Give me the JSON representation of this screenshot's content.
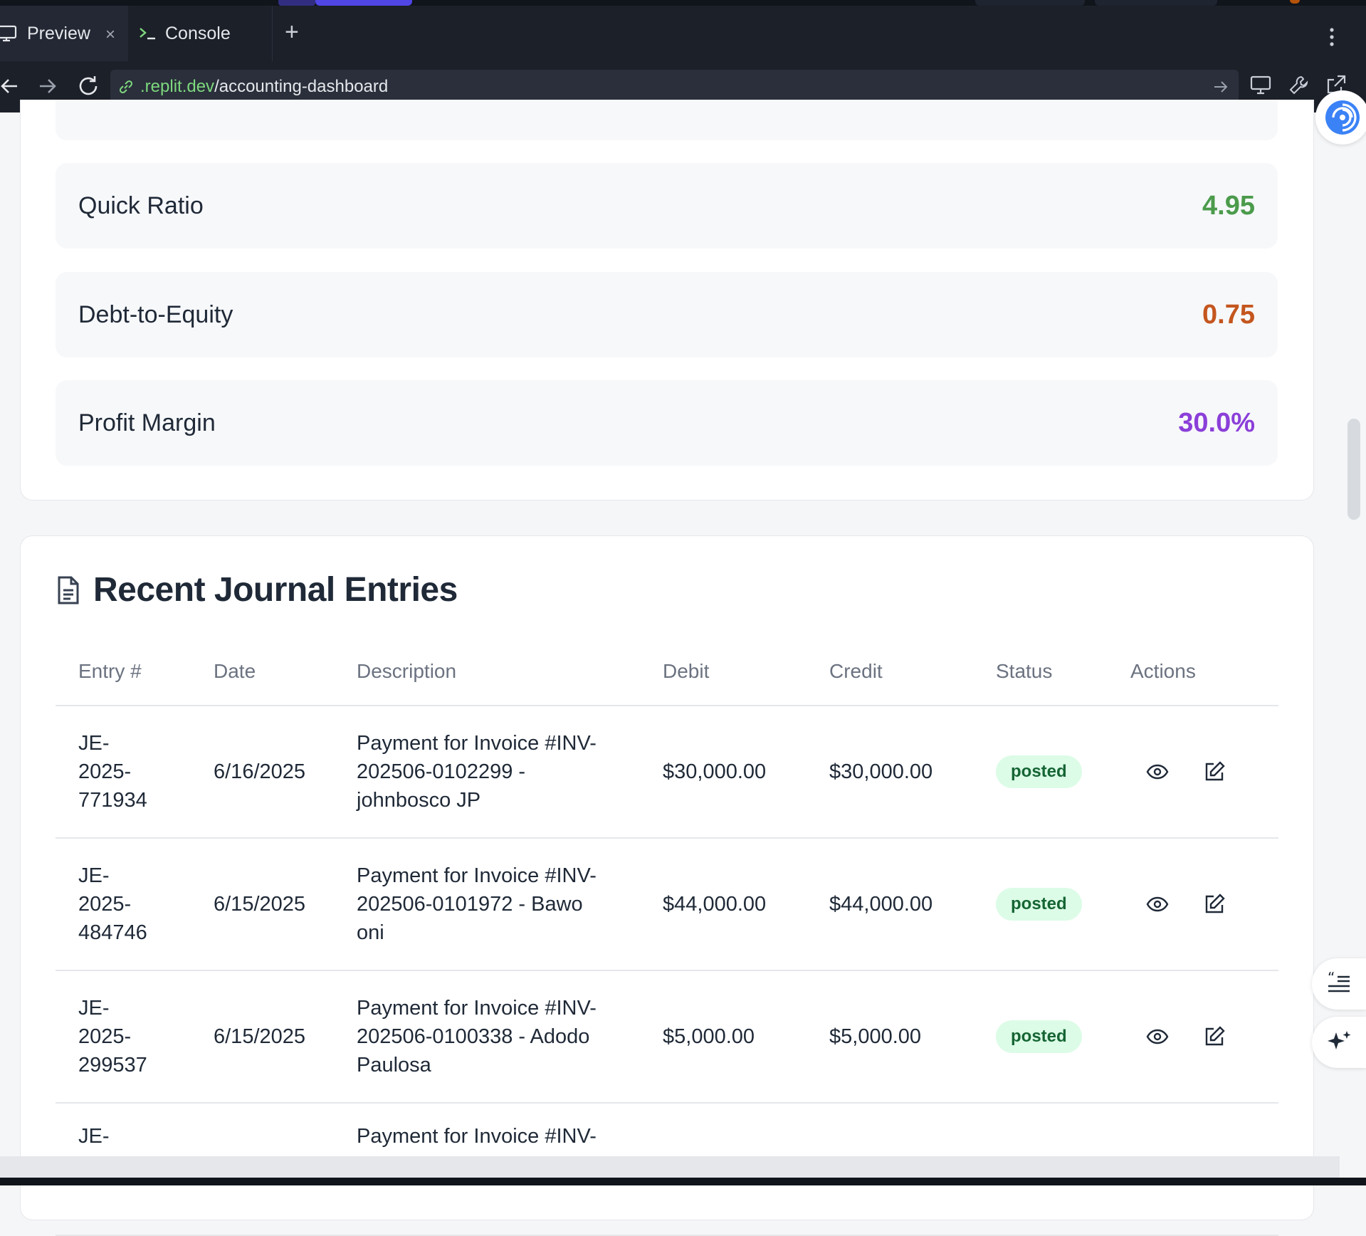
{
  "browser": {
    "tabs": [
      {
        "label": "Preview",
        "icon": "monitor-icon"
      },
      {
        "label": "Console",
        "icon": "terminal-icon"
      }
    ],
    "close_glyph": "×",
    "add_glyph": "+",
    "url_host": ".replit.dev",
    "url_path": "/accounting-dashboard"
  },
  "ratios": [
    {
      "label": "Quick Ratio",
      "value": "4.95",
      "color": "#4b9b4b"
    },
    {
      "label": "Debt-to-Equity",
      "value": "0.75",
      "color": "#c4561e"
    },
    {
      "label": "Profit Margin",
      "value": "30.0%",
      "color": "#8b3fd9"
    }
  ],
  "journal": {
    "title": "Recent Journal Entries",
    "columns": [
      "Entry #",
      "Date",
      "Description",
      "Debit",
      "Credit",
      "Status",
      "Actions"
    ],
    "rows": [
      {
        "entry": "JE-2025-771934",
        "date": "6/16/2025",
        "description": "Payment for Invoice #INV-202506-0102299 - johnbosco JP",
        "debit": "$30,000.00",
        "credit": "$30,000.00",
        "status": "posted"
      },
      {
        "entry": "JE-2025-484746",
        "date": "6/15/2025",
        "description": "Payment for Invoice #INV-202506-0101972 - Bawo oni",
        "debit": "$44,000.00",
        "credit": "$44,000.00",
        "status": "posted"
      },
      {
        "entry": "JE-2025-299537",
        "date": "6/15/2025",
        "description": "Payment for Invoice #INV-202506-0100338 - Adodo Paulosa",
        "debit": "$5,000.00",
        "credit": "$5,000.00",
        "status": "posted"
      },
      {
        "entry": "JE-",
        "date": "",
        "description": "Payment for Invoice #INV-",
        "debit": "",
        "credit": "",
        "status": ""
      }
    ]
  },
  "colors": {
    "status_bg": "#dcfce7",
    "status_text": "#166534",
    "url_host": "#7dd87d"
  }
}
